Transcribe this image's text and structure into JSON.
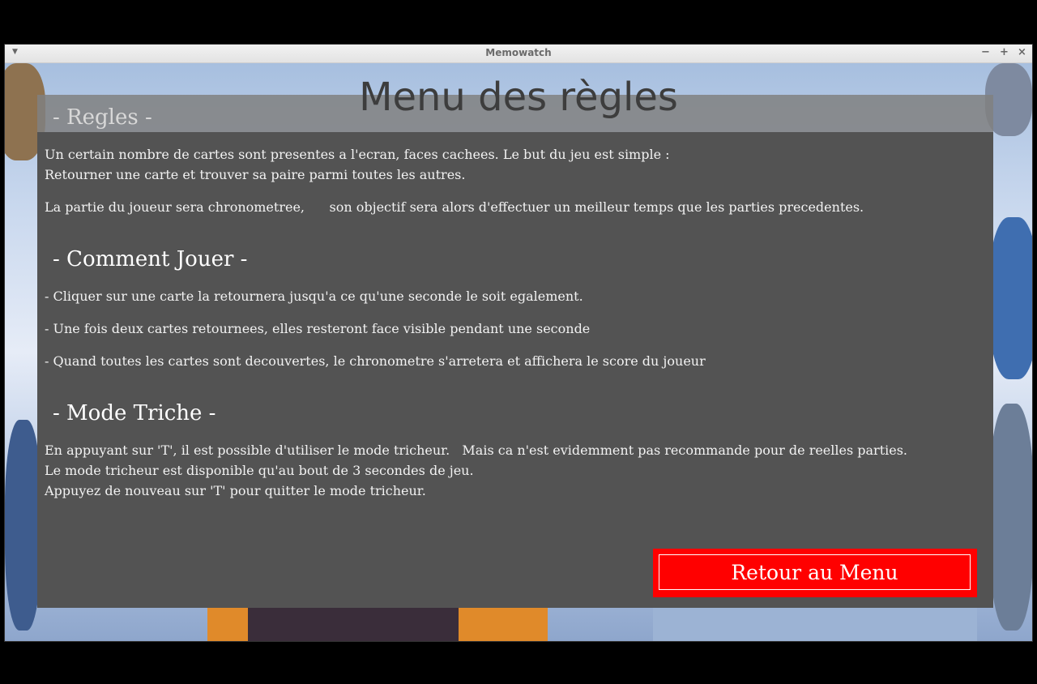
{
  "window": {
    "title": "Memowatch",
    "menu_icon": "chevron-down-icon",
    "minimize_glyph": "−",
    "maximize_glyph": "+",
    "close_glyph": "×"
  },
  "page": {
    "title": "Menu des règles"
  },
  "sections": {
    "rules": {
      "title": "- Regles -",
      "lines": [
        "Un certain nombre de cartes sont presentes a l'ecran, faces cachees. Le but du jeu est simple :",
        "Retourner une carte et trouver sa paire parmi toutes les autres.",
        "La partie du joueur sera chronometree,      son objectif sera alors d'effectuer un meilleur temps que les parties precedentes."
      ]
    },
    "how_to_play": {
      "title": "- Comment Jouer -",
      "lines": [
        "- Cliquer sur une carte la retournera jusqu'a ce qu'une seconde le soit egalement.",
        "- Une fois deux cartes retournees, elles resteront face visible pendant une seconde",
        "- Quand toutes les cartes sont decouvertes, le chronometre s'arretera et affichera le score du joueur"
      ]
    },
    "cheat_mode": {
      "title": "- Mode Triche -",
      "lines": [
        "En appuyant sur 'T', il est possible d'utiliser le mode tricheur.   Mais ca n'est evidemment pas recommande pour de reelles parties.",
        "Le mode tricheur est disponible qu'au bout de 3 secondes de jeu.",
        "Appuyez de nouveau sur 'T' pour quitter le mode tricheur."
      ]
    }
  },
  "buttons": {
    "return_label": "Retour au Menu"
  },
  "colors": {
    "panel": "#535353",
    "button": "#ff0000",
    "text": "#ffffff"
  }
}
